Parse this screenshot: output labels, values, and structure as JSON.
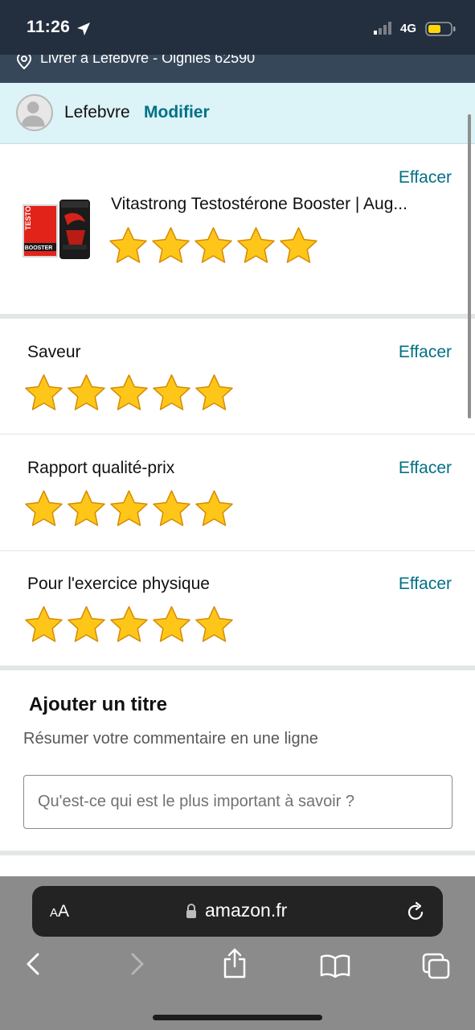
{
  "status": {
    "time": "11:26",
    "network": "4G"
  },
  "deliver": {
    "text": "Livrer à Lefebvre - Oignies 62590"
  },
  "user": {
    "name": "Lefebvre",
    "modify_label": "Modifier"
  },
  "product": {
    "title": "Vitastrong Testostérone Booster | Aug...",
    "clear_label": "Effacer",
    "rating": 5,
    "image_label": "TESTO BOOSTER"
  },
  "ratings": [
    {
      "label": "Saveur",
      "clear_label": "Effacer",
      "rating": 5
    },
    {
      "label": "Rapport qualité-prix",
      "clear_label": "Effacer",
      "rating": 5
    },
    {
      "label": "Pour l'exercice physique",
      "clear_label": "Effacer",
      "rating": 5
    }
  ],
  "title_section": {
    "heading": "Ajouter un titre",
    "subtitle": "Résumer votre commentaire en une ligne",
    "placeholder": "Qu'est-ce qui est le plus important à savoir ?"
  },
  "browser": {
    "aa_big": "A",
    "aa_small": "A",
    "url": "amazon.fr"
  },
  "colors": {
    "link": "#007185",
    "star_fill": "#ffc61a",
    "star_stroke": "#d58b00",
    "header_bg": "#232f3e",
    "user_bar_bg": "#dcf3f8"
  },
  "icons": [
    "location-arrow-icon",
    "signal-icon",
    "battery-icon",
    "pin-icon",
    "avatar-icon",
    "star-icon",
    "lock-icon",
    "reload-icon",
    "back-icon",
    "forward-icon",
    "share-icon",
    "bookmarks-icon",
    "tabs-icon"
  ]
}
